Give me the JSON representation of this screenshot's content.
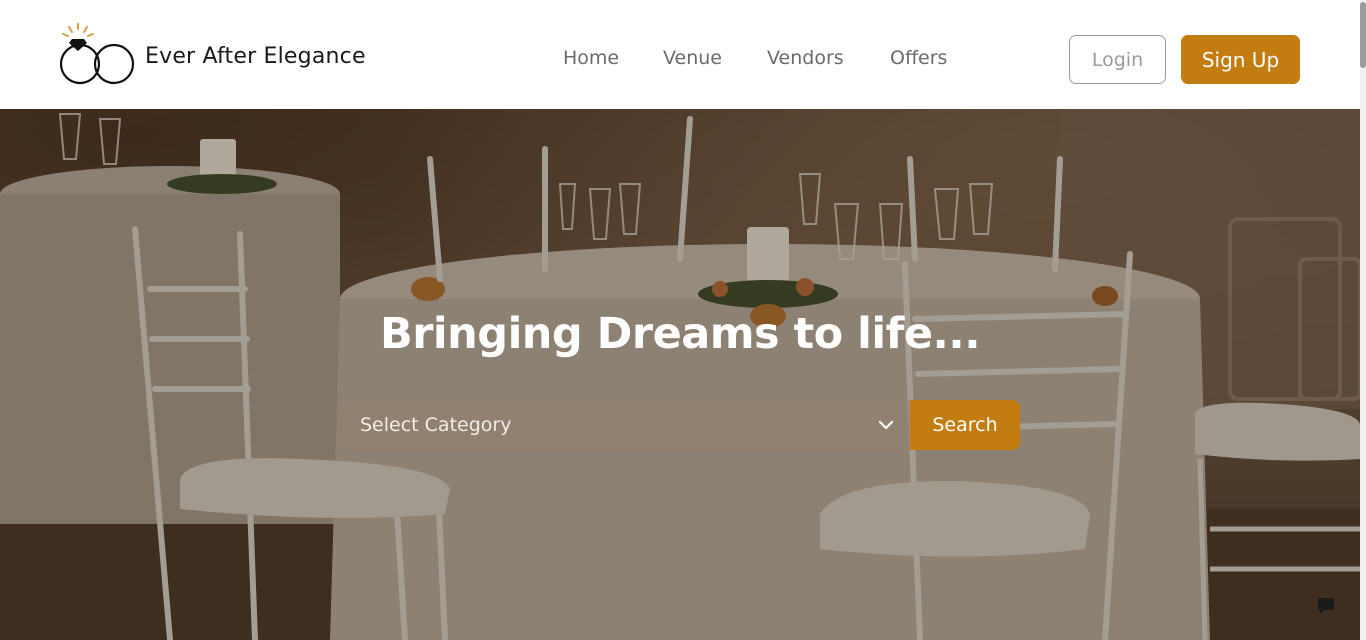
{
  "brand": {
    "name": "Ever After Elegance",
    "accent": "#c27c10"
  },
  "nav": {
    "items": [
      {
        "label": "Home"
      },
      {
        "label": "Venue"
      },
      {
        "label": "Vendors"
      },
      {
        "label": "Offers"
      }
    ]
  },
  "auth": {
    "login_label": "Login",
    "signup_label": "Sign Up"
  },
  "hero": {
    "title": "Bringing Dreams to life...",
    "category_select": {
      "selected": "Select Category"
    },
    "search_label": "Search"
  },
  "icons": {
    "logo": "rings-diamond-icon",
    "select": "chevron-down-icon",
    "chat": "chat-bubble-icon"
  }
}
